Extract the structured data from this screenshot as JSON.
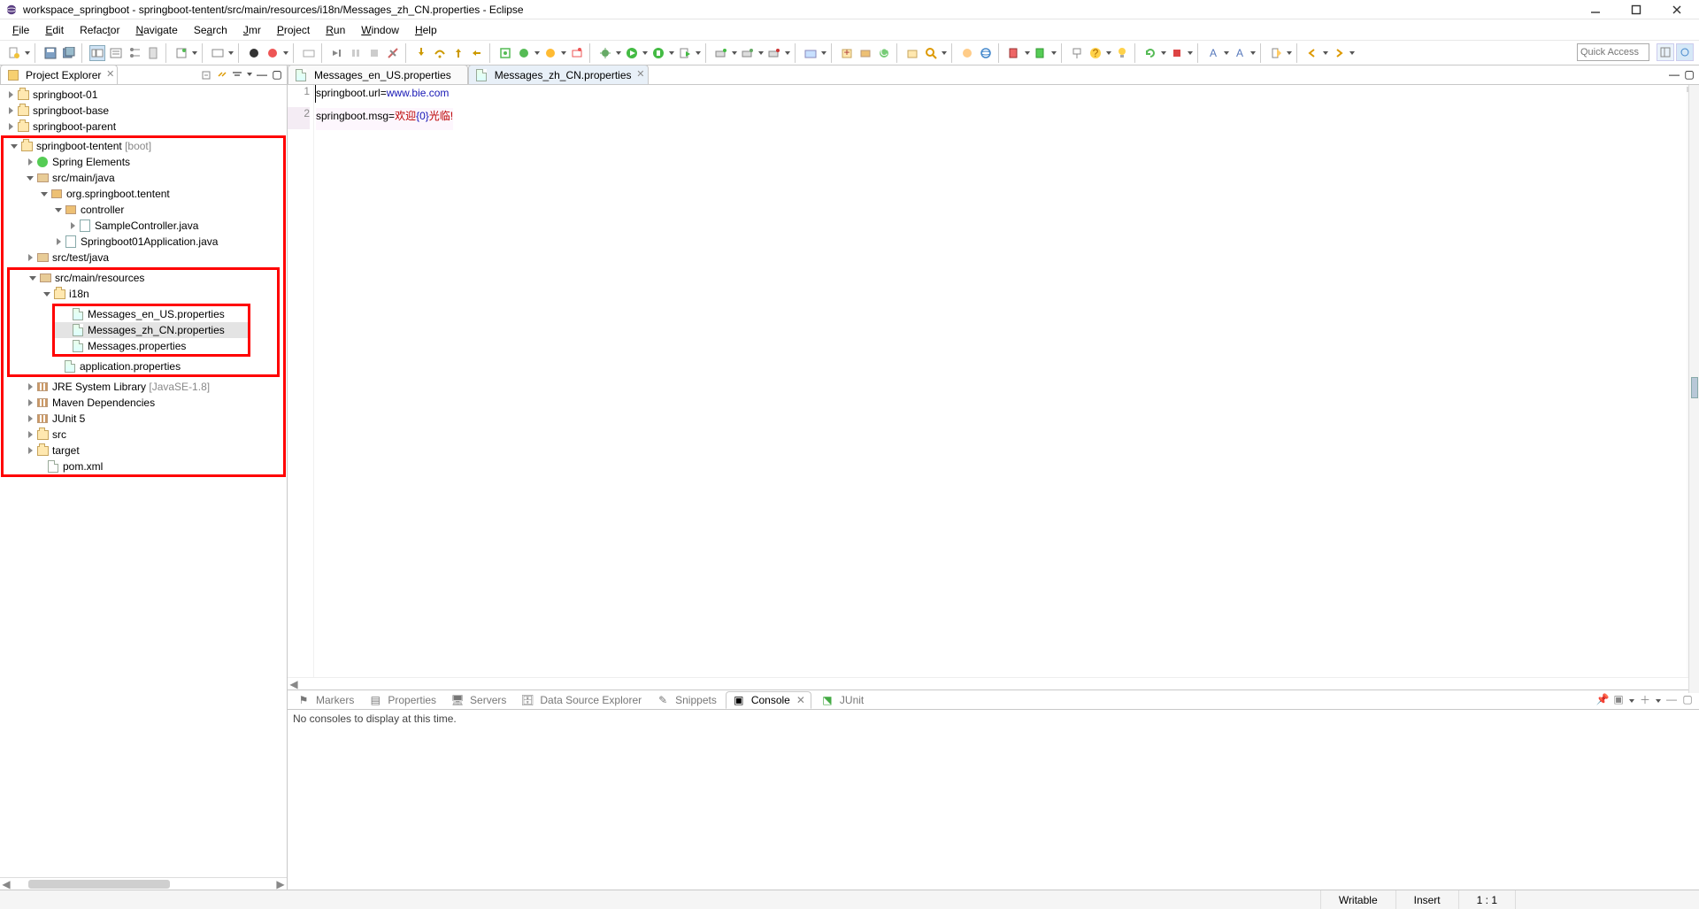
{
  "title": "workspace_springboot - springboot-tentent/src/main/resources/i18n/Messages_zh_CN.properties - Eclipse",
  "menus": [
    "File",
    "Edit",
    "Refactor",
    "Navigate",
    "Search",
    "Jmr",
    "Project",
    "Run",
    "Window",
    "Help"
  ],
  "quick_access_placeholder": "Quick Access",
  "project_explorer": {
    "title": "Project Explorer"
  },
  "tree": {
    "sb01": "springboot-01",
    "sbbase": "springboot-base",
    "sbparent": "springboot-parent",
    "sbt": "springboot-tentent",
    "sbt_decor": "[boot]",
    "spring_el": "Spring Elements",
    "src_main_java": "src/main/java",
    "pkg": "org.springboot.tentent",
    "controller": "controller",
    "sample_ctrl": "SampleController.java",
    "app_java": "Springboot01Application.java",
    "src_test_java": "src/test/java",
    "src_main_res": "src/main/resources",
    "i18n": "i18n",
    "msg_en": "Messages_en_US.properties",
    "msg_zh": "Messages_zh_CN.properties",
    "msg_def": "Messages.properties",
    "app_props": "application.properties",
    "jre": "JRE System Library",
    "jre_decor": "[JavaSE-1.8]",
    "maven": "Maven Dependencies",
    "junit": "JUnit 5",
    "src": "src",
    "target": "target",
    "pom": "pom.xml"
  },
  "editor": {
    "tab1": "Messages_en_US.properties",
    "tab2": "Messages_zh_CN.properties",
    "line1_key": "springboot.url",
    "line1_eq": "=",
    "line1_val": "www.bie.com",
    "line2_key": "springboot.msg",
    "line2_eq": "=",
    "line2_v1": "欢迎",
    "line2_v2": "{0}",
    "line2_v3": "光临!"
  },
  "bottom_tabs": {
    "markers": "Markers",
    "properties": "Properties",
    "servers": "Servers",
    "dse": "Data Source Explorer",
    "snippets": "Snippets",
    "console": "Console",
    "junit": "JUnit"
  },
  "console_empty": "No consoles to display at this time.",
  "status": {
    "writable": "Writable",
    "insert": "Insert",
    "pos": "1 : 1"
  }
}
